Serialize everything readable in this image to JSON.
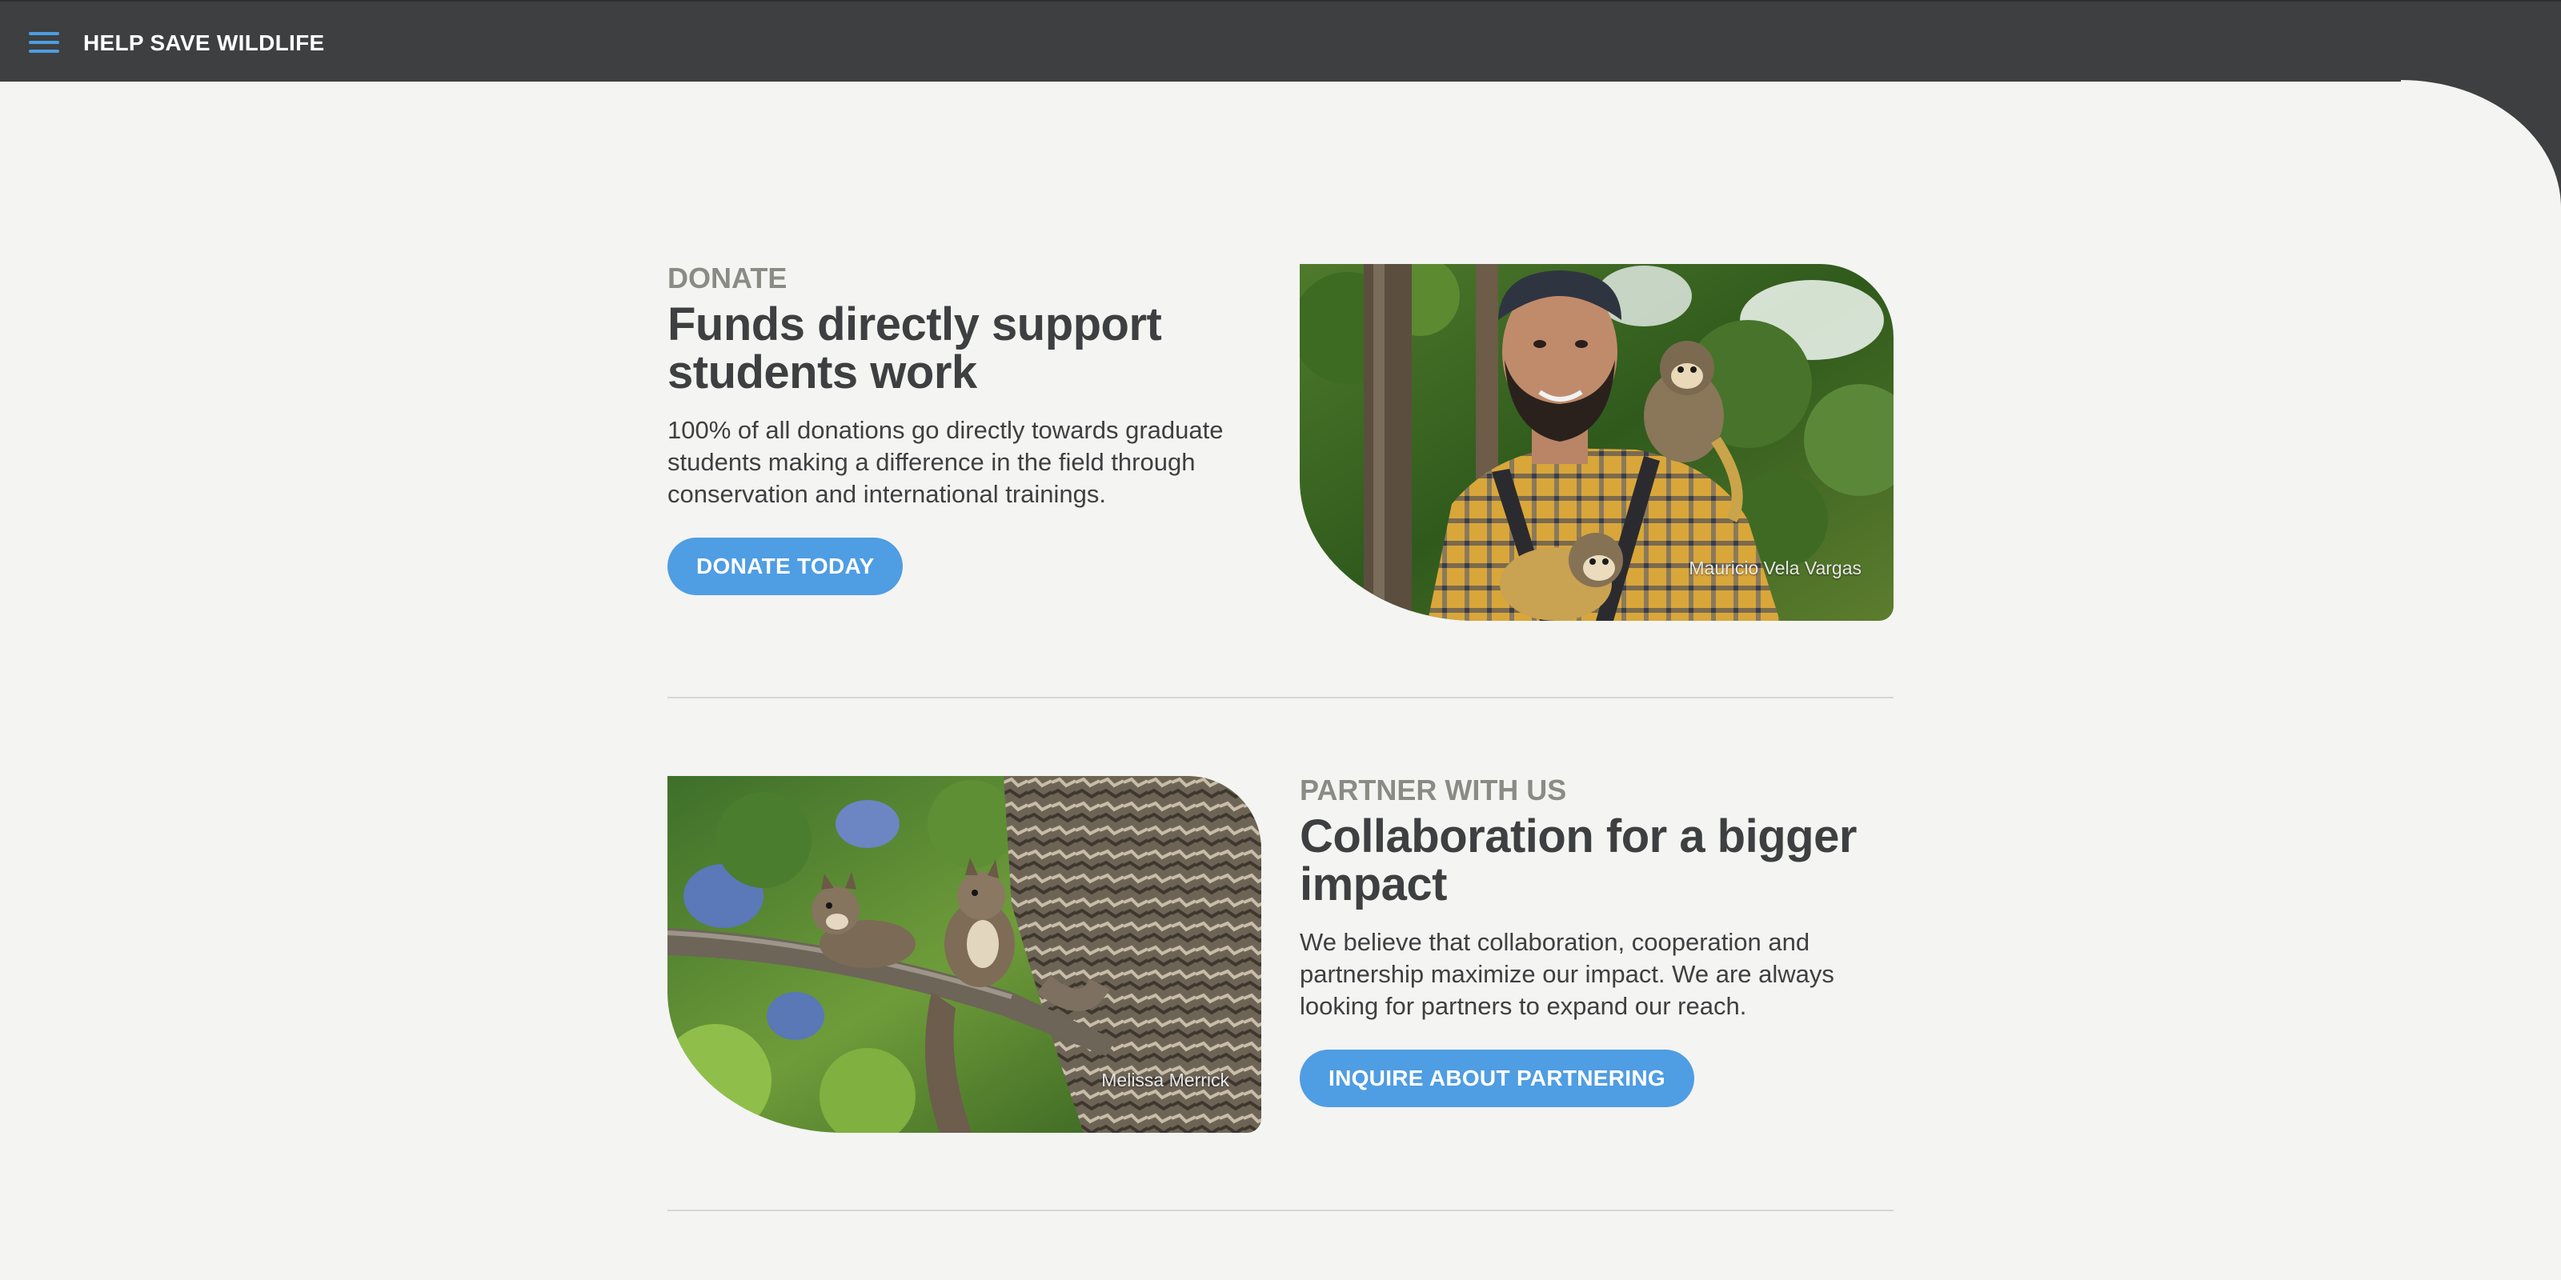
{
  "header": {
    "title": "HELP SAVE WILDLIFE",
    "menu_icon": "hamburger-menu-icon",
    "background": "#3e3f41",
    "accent": "#4f9de3"
  },
  "sections": [
    {
      "eyebrow": "DONATE",
      "headline": "Funds directly support students work",
      "body": "100% of all donations go directly towards graduate students making a difference in the field through conservation and international trainings.",
      "button_label": "DONATE TODAY",
      "photo_credit": "Mauricio Vela Vargas"
    },
    {
      "eyebrow": "PARTNER WITH US",
      "headline": "Collaboration for a bigger impact",
      "body": "We believe that collaboration, cooperation and partnership maximize our impact. We are always looking for partners to expand our reach.",
      "button_label": "INQUIRE ABOUT PARTNERING",
      "photo_credit": "Melissa Merrick"
    }
  ],
  "colors": {
    "page_background": "#f4f4f2",
    "eyebrow": "#8b8b86",
    "text": "#3e3f41",
    "button": "#4f9de3",
    "divider": "#d6d6d3"
  }
}
